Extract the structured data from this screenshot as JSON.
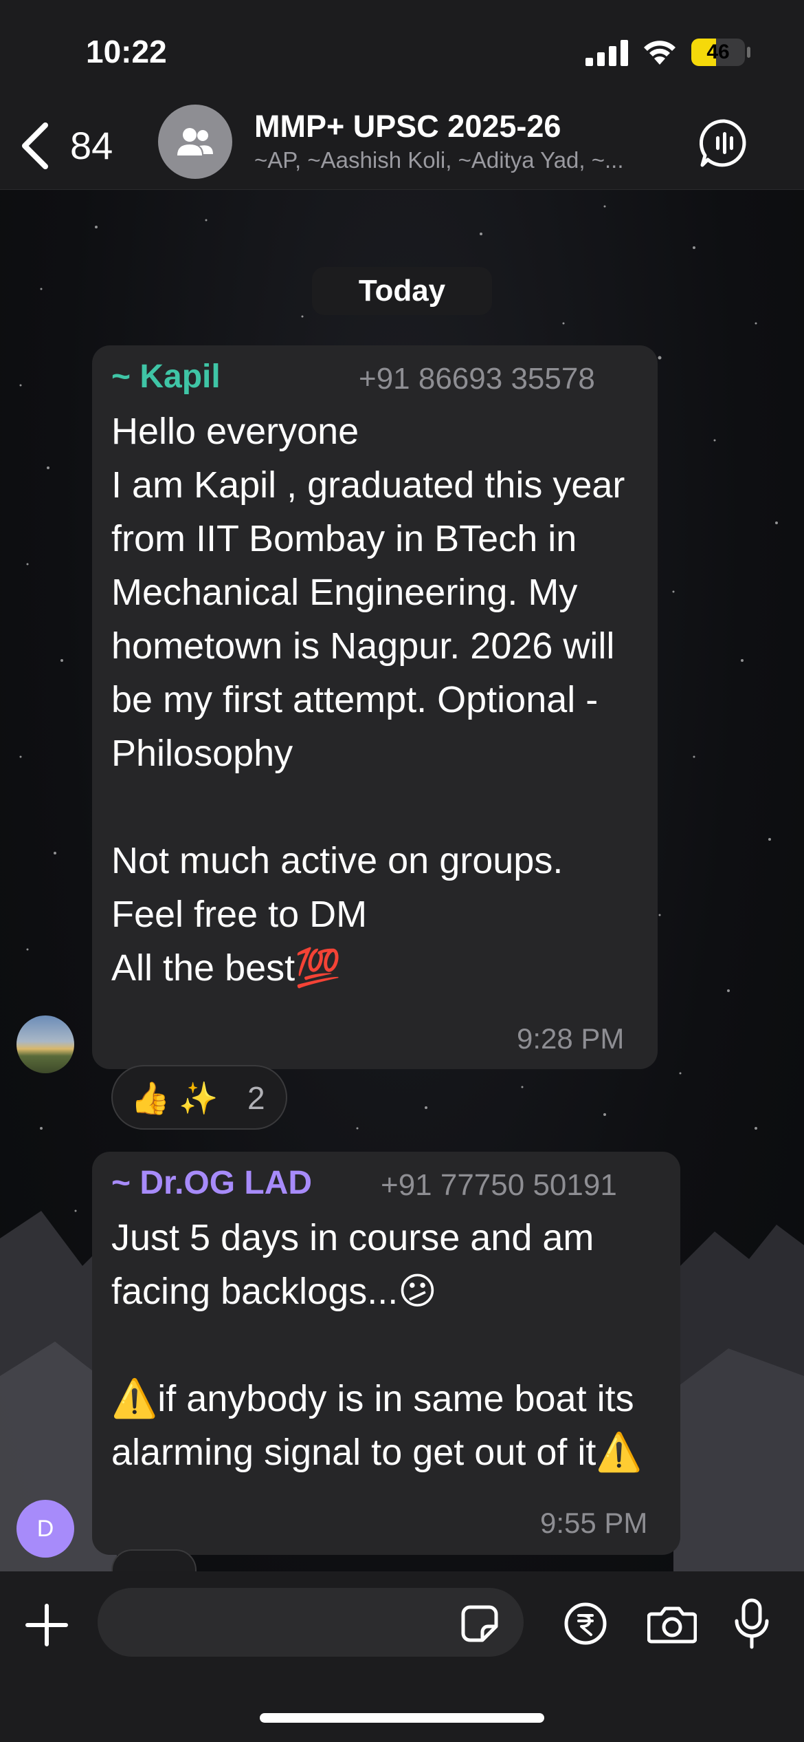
{
  "status_bar": {
    "time": "10:22",
    "battery_level": "46",
    "battery_fraction": 0.46,
    "battery_color": "#f5d90a"
  },
  "header": {
    "back_count": "84",
    "group_title": "MMP+ UPSC 2025-26",
    "group_members": "~AP, ~Aashish Koli, ~Aditya Yad, ~..."
  },
  "date_separator": "Today",
  "messages": [
    {
      "sender": "~ Kapil",
      "sender_color": "#3fc5a6",
      "phone": "+91 86693 35578",
      "text": "Hello everyone\nI am Kapil , graduated this year from IIT Bombay in BTech in Mechanical Engineering. My hometown is Nagpur. 2026 will be my first attempt. Optional - Philosophy\n\nNot much active on groups.\nFeel free to DM\nAll the best💯",
      "time": "9:28 PM",
      "reactions": {
        "emojis": "👍 ✨",
        "count": "2"
      }
    },
    {
      "sender": "~ Dr.OG LAD",
      "sender_color": "#a78bfa",
      "phone": "+91 77750 50191",
      "text": "Just 5 days in course and am facing backlogs...😕\n\n⚠️if anybody is in same boat its alarming signal to get out of it⚠️",
      "time": "9:55 PM",
      "avatar_letter": "D"
    }
  ],
  "input_bar": {
    "placeholder": ""
  }
}
